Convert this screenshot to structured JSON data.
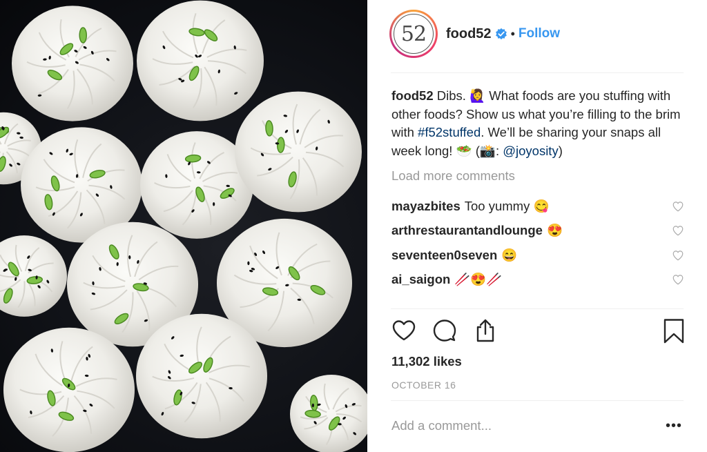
{
  "post": {
    "image_alt": "Steamed buns with sesame seeds and green onions"
  },
  "header": {
    "avatar_text": "52",
    "username": "food52",
    "separator": "•",
    "follow_label": "Follow"
  },
  "caption": {
    "username": "food52",
    "text_1": " Dibs. 🙋‍♀️ What foods are you stuffing with other foods? Show us what you’re filling to the brim with ",
    "hashtag": "#f52stuffed",
    "text_2": ". We’ll be sharing your snaps all week long! 🥗 (📸: ",
    "mention": "@joyosity",
    "text_3": ")"
  },
  "load_more_label": "Load more comments",
  "comments": [
    {
      "username": "mayazbites",
      "text": "Too yummy 😋"
    },
    {
      "username": "arthrestaurantandlounge",
      "text": "😍"
    },
    {
      "username": "seventeen0seven",
      "text": "😄"
    },
    {
      "username": "ai_saigon",
      "text": "🥢😍🥢"
    }
  ],
  "likes": "11,302 likes",
  "date": "OCTOBER 16",
  "add_comment_placeholder": "Add a comment...",
  "more_label": "•••",
  "colors": {
    "accent": "#3897f0",
    "link": "#003569",
    "muted": "#999999",
    "text": "#262626"
  }
}
